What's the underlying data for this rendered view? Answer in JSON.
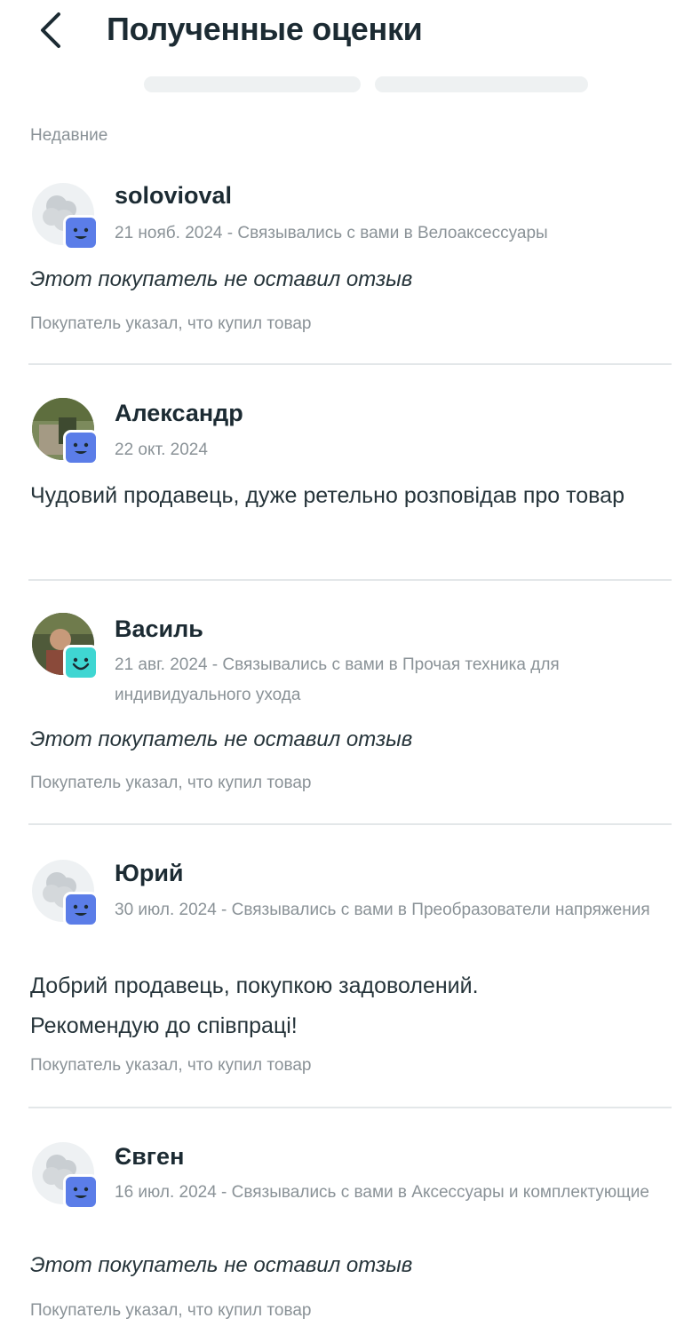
{
  "header": {
    "title": "Полученные оценки",
    "back_icon": "chevron-left-icon"
  },
  "section": {
    "label": "Недавние"
  },
  "reviews": [
    {
      "name": "solovioval",
      "meta": "21 нояб. 2024 - Связывались с вами в Велоаксессуары",
      "comment": "Этот покупатель не оставил отзыв",
      "note": "Покупатель указал, что купил товар",
      "badge_color": "#5b7de8"
    },
    {
      "name": "Александр",
      "meta": "22 окт. 2024",
      "comment": "Чудовий продавець, дуже ретельно розповідав про товар",
      "badge_color": "#5b7de8"
    },
    {
      "name": "Василь",
      "meta": "21 авг. 2024 - Связывались с вами в Прочая техника для индивидуального ухода",
      "comment": "Этот покупатель не оставил отзыв",
      "note": "Покупатель указал, что купил товар",
      "badge_color": "#3fd6d2"
    },
    {
      "name": "Юрий",
      "meta": "30 июл. 2024 - Связывались с вами в Преобразователи напряжения",
      "comment": "Добрий продавець, покупкою задоволений. Рекомендую до співпраці!",
      "note": "Покупатель указал, что купил товар",
      "badge_color": "#5b7de8"
    },
    {
      "name": "Євген",
      "meta": "16 июл. 2024 - Связывались с вами в Аксессуары и комплектующие",
      "comment": "Этот покупатель не оставил отзыв",
      "note": "Покупатель указал, что купил товар",
      "badge_color": "#5b7de8"
    }
  ]
}
